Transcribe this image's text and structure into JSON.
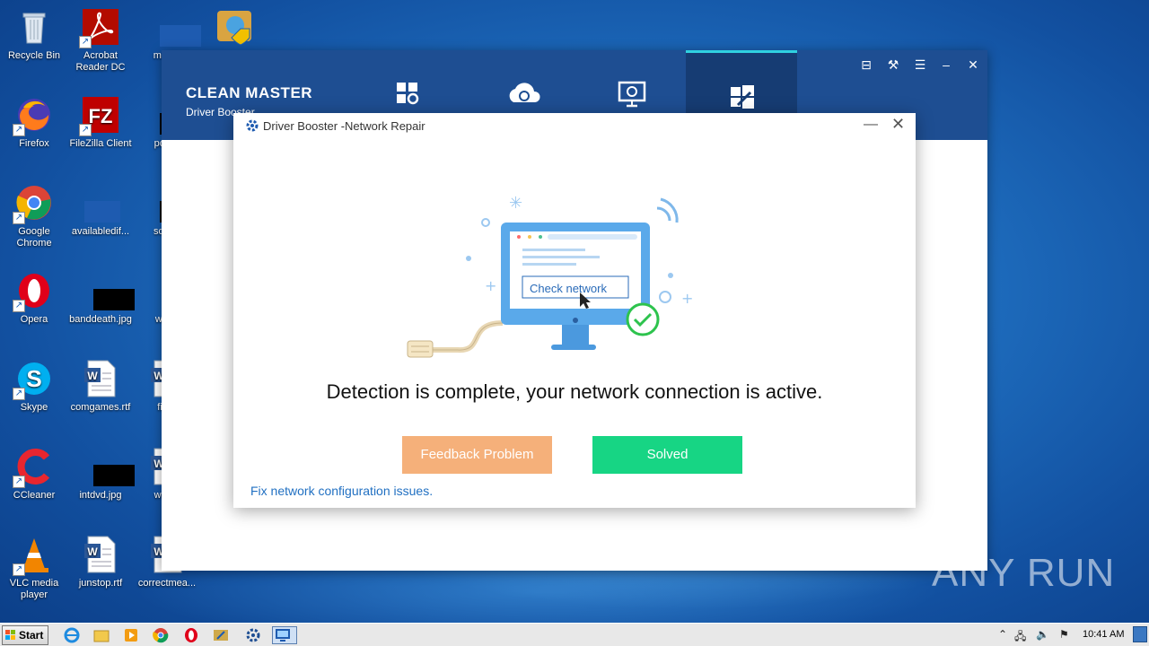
{
  "desktop": {
    "icons": [
      {
        "label": "Recycle Bin"
      },
      {
        "label": "Acrobat Reader DC"
      },
      {
        "label": "memb"
      },
      {
        "label": "Firefox"
      },
      {
        "label": "FileZilla Client"
      },
      {
        "label": "postsl"
      },
      {
        "label": "Google Chrome"
      },
      {
        "label": "availabledif..."
      },
      {
        "label": "somet"
      },
      {
        "label": "Opera"
      },
      {
        "label": "banddeath.jpg"
      },
      {
        "label": "wede"
      },
      {
        "label": "Skype"
      },
      {
        "label": "comgames.rtf"
      },
      {
        "label": "firstr"
      },
      {
        "label": "CCleaner"
      },
      {
        "label": "intdvd.jpg"
      },
      {
        "label": "windo"
      },
      {
        "label": "VLC media player"
      },
      {
        "label": "junstop.rtf"
      },
      {
        "label": "correctmea..."
      }
    ]
  },
  "cleanmaster": {
    "brand_title": "CLEAN MASTER",
    "brand_subtitle": "Driver Booster",
    "accent_color": "#1e4e92",
    "tabs": [
      {
        "icon": "apps-gear-icon"
      },
      {
        "icon": "cloud-refresh-icon"
      },
      {
        "icon": "monitor-search-icon"
      },
      {
        "icon": "windows-repair-icon",
        "active": true
      }
    ]
  },
  "dialog": {
    "title": "Driver Booster -Network Repair",
    "illustration_button": "Check network",
    "message": "Detection is complete, your network connection is active.",
    "feedback_button": "Feedback Problem",
    "solved_button": "Solved",
    "fix_link": "Fix network configuration issues.",
    "feedback_color": "#f5b07a",
    "solved_color": "#17d584"
  },
  "watermark": "ANY RUN",
  "taskbar": {
    "start_label": "Start",
    "clock": "10:41 AM"
  }
}
